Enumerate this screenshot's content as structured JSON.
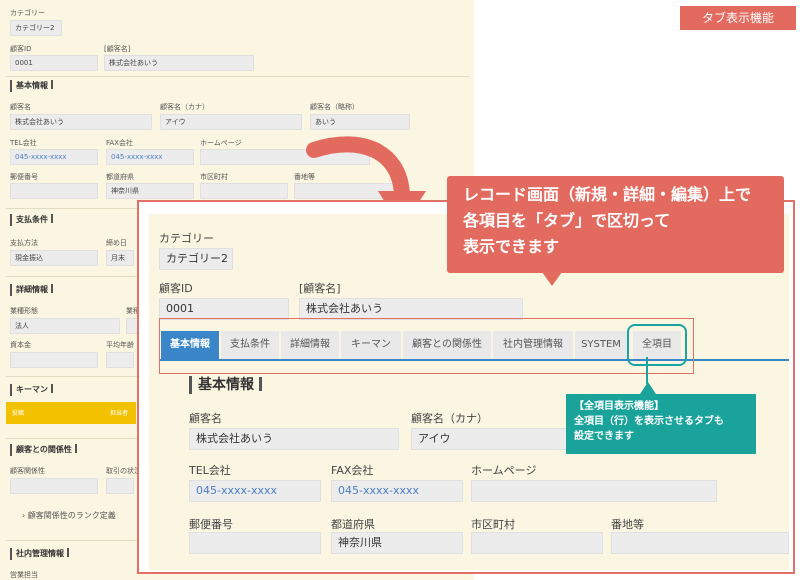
{
  "badge": "タブ表示機能",
  "colors": {
    "accent_red": "#e26a5f",
    "teal": "#19a39b",
    "tab_blue": "#3a86c8",
    "form_bg": "#fbf6e2"
  },
  "bg": {
    "category_label": "カテゴリー",
    "category_value": "カテゴリー2",
    "customer_id_label": "顧客ID",
    "customer_id_value": "0001",
    "customer_name_label": "[顧客名]",
    "customer_name_value": "株式会社あいう",
    "sec_basic": "基本情報",
    "name_label": "顧客名",
    "name_value": "株式会社あいう",
    "kana_label": "顧客名（カナ）",
    "kana_value": "アイウ",
    "short_label": "顧客名（略称）",
    "short_value": "あいう",
    "tel_label": "TEL会社",
    "tel_value": "045-xxxx-xxxx",
    "fax_label": "FAX会社",
    "fax_value": "045-xxxx-xxxx",
    "homepage_label": "ホームページ",
    "postal_label": "郵便番号",
    "pref_label": "都道府県",
    "pref_value": "神奈川県",
    "city_label": "市区町村",
    "street_label": "番地等",
    "sec_payment": "支払条件",
    "pay_method_label": "支払方法",
    "pay_method_value": "現金振込",
    "closing_label": "締め日",
    "closing_value": "月末",
    "sec_detail": "詳細情報",
    "industry_label": "業種形態",
    "industry_value": "法人",
    "industry2_label": "業種",
    "capital_label": "資本金",
    "avg_label": "平均年齢",
    "sec_keyman": "キーマン",
    "keyman_col1": "役職",
    "keyman_col2": "担当者",
    "sec_relation": "顧客との関係性",
    "relation_label": "顧客関係性",
    "relation2_label": "取引の状況",
    "relation_link": "顧客関係性のランク定義",
    "sec_internal": "社内管理情報",
    "internal_label": "営業担当"
  },
  "big": {
    "category_label": "カテゴリー",
    "category_value": "カテゴリー2",
    "customer_id_label": "顧客ID",
    "customer_id_value": "0001",
    "customer_name_label": "[顧客名]",
    "customer_name_value": "株式会社あいう",
    "tabs": [
      "基本情報",
      "支払条件",
      "詳細情報",
      "キーマン",
      "顧客との関係性",
      "社内管理情報",
      "SYSTEM",
      "全項目"
    ],
    "sec_basic": "基本情報",
    "name_label": "顧客名",
    "name_value": "株式会社あいう",
    "kana_label": "顧客名（カナ）",
    "kana_value": "アイウ",
    "tel_label": "TEL会社",
    "tel_value": "045-xxxx-xxxx",
    "fax_label": "FAX会社",
    "fax_value": "045-xxxx-xxxx",
    "homepage_label": "ホームページ",
    "postal_label": "郵便番号",
    "pref_label": "都道府県",
    "pref_value": "神奈川県",
    "city_label": "市区町村",
    "street_label": "番地等"
  },
  "callout_main": [
    "レコード画面（新規・詳細・編集）上で",
    "各項目を「タブ」で区切って",
    "表示できます"
  ],
  "callout_teal": [
    "【全項目表示機能】",
    "全項目（行）を表示させるタブも",
    "設定できます"
  ]
}
